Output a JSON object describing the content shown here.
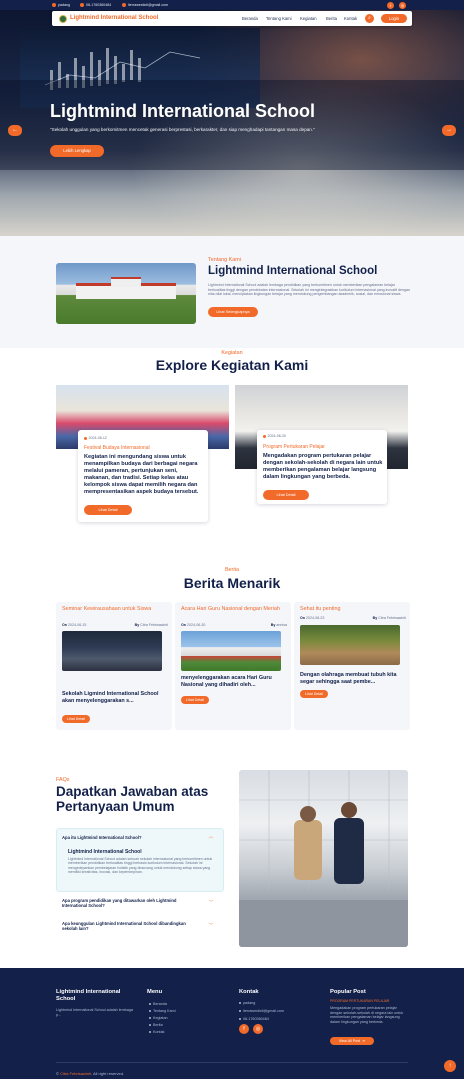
{
  "topbar": {
    "location": "padang",
    "phone": "08-1760360484",
    "email": "lterrawesticti@gmail.com"
  },
  "nav": {
    "brand": "Lightmind International School",
    "links": [
      "Beranda",
      "Tentang Kami",
      "Kegiatan",
      "Berita",
      "Kontak"
    ],
    "login": "Login"
  },
  "hero": {
    "title": "Lightmind International School",
    "subtitle": "\"Sekolah unggulan yang berkomitmen mencetak generasi berprestasi, berkarakter, dan siap menghadapi tantangan masa depan.\"",
    "button": "Lebih Lengkap",
    "prev": "←",
    "next": "→"
  },
  "about": {
    "kicker": "Tentang Kami",
    "title": "Lightmind International School",
    "text": "Lightmind International School adalah lembaga pendidikan yang berkomitmen untuk memberikan pengalaman belajar berkualitas tinggi dengan pendekatan internasional. Sekolah ini mengintegrasikan kurikulum internasional yang inovatif dengan nilai-nilai lokal, menciptakan lingkungan belajar yang mendukung pengembangan akademik, sosial, dan emosional siswa.",
    "button": "Lihat Selengkapnya"
  },
  "activities": {
    "kicker": "Kegiatan",
    "title": "Explore Kegiatan Kami",
    "items": [
      {
        "date": "2024-06-12",
        "category": "Festival Budaya Internasional",
        "text": "Kegiatan ini mengundang siswa untuk menampilkan budaya dari berbagai negara melalui pameran, pertunjukan seni, makanan, dan tradisi. Setiap kelas atau kelompok siswa dapat memilih negara dan mempresentasikan aspek budaya tersebut.",
        "button": "Lihat Detail"
      },
      {
        "date": "2024-06-30",
        "category": "Program Pertukaran Pelajar",
        "text": "Mengadakan program pertukaran pelajar dengan sekolah-sekolah di negara lain untuk memberikan pengalaman belajar langsung dalam lingkungan yang berbeda.",
        "button": "Lihat Detail"
      }
    ]
  },
  "news": {
    "kicker": "Berita",
    "title": "Berita Menarik",
    "items": [
      {
        "title": "Seminar Kewirausahaan untuk Siswa",
        "on_label": "On",
        "date": "2024-06-15",
        "by_label": "By",
        "author": "Citra Febrisawinti",
        "text": "Sekolah Ligmind International School akan menyelenggarakan s...",
        "button": "Lihat Detail"
      },
      {
        "title": "Acara Hari Guru Nasional dengan Meriah",
        "on_label": "On",
        "date": "2024-06-30",
        "by_label": "By",
        "author": "annisa",
        "text": "menyelenggarakan acara Hari Guru Nasional yang dihadiri oleh...",
        "button": "Lihat Detail"
      },
      {
        "title": "Sehat itu penting",
        "on_label": "On",
        "date": "2024-06-23",
        "by_label": "By",
        "author": "Citra Febrisawinti",
        "text": "Dengan olahraga membuat tubuh kita segar sehingga saat pembe...",
        "button": "Lihat Detail"
      }
    ]
  },
  "faq": {
    "kicker": "FAQs",
    "title": "Dapatkan Jawaban atas Pertanyaan Umum",
    "questions": [
      "Apa itu Lightmind International School?",
      "Apa program pendidikan yang ditawarkan oleh Lightmind International School?",
      "Apa keunggulan Lightmind International School dibandingkan sekolah lain?"
    ],
    "answer_title": "Lightmind International School",
    "answer": "Lightmind International School adalah sebuah sekolah internasional yang berkomitmen untuk memberikan pendidikan berkualitas tinggi berbasis kurikulum internasional. Sekolah ini mengedepankan pembelajaran holistik yang dirancang untuk mendukung setiap siswa yang memiliki kreativitas, inovasi, dan kepemimpinan."
  },
  "footer": {
    "school_title": "Lightmind International School",
    "school_text": "Lightmind International School adalah lembaga p...",
    "menu_title": "Menu",
    "menu": [
      "Beranda",
      "Tentang Kami",
      "Kegiatan",
      "Berita",
      "Kontak"
    ],
    "contact_title": "Kontak",
    "contact": [
      "padang",
      "lterrawesticti@gmail.com",
      "08-1760360484"
    ],
    "popular_title": "Popular Post",
    "popular_name": "PROGRAM PERTUKARAN PELAJAR",
    "popular_text": "Mengadakan program pertukaran pelajar dengan sekolah-sekolah di negara lain untuk memberikan pengalaman belajar langsung dalam lingkungan yang berbeda.",
    "popular_button": "View All Post",
    "copyright_name": "Citra Febrisawinti",
    "copyright_text": ". All right reserved."
  },
  "colors": {
    "accent": "#f26a2a",
    "navy": "#13214a"
  }
}
